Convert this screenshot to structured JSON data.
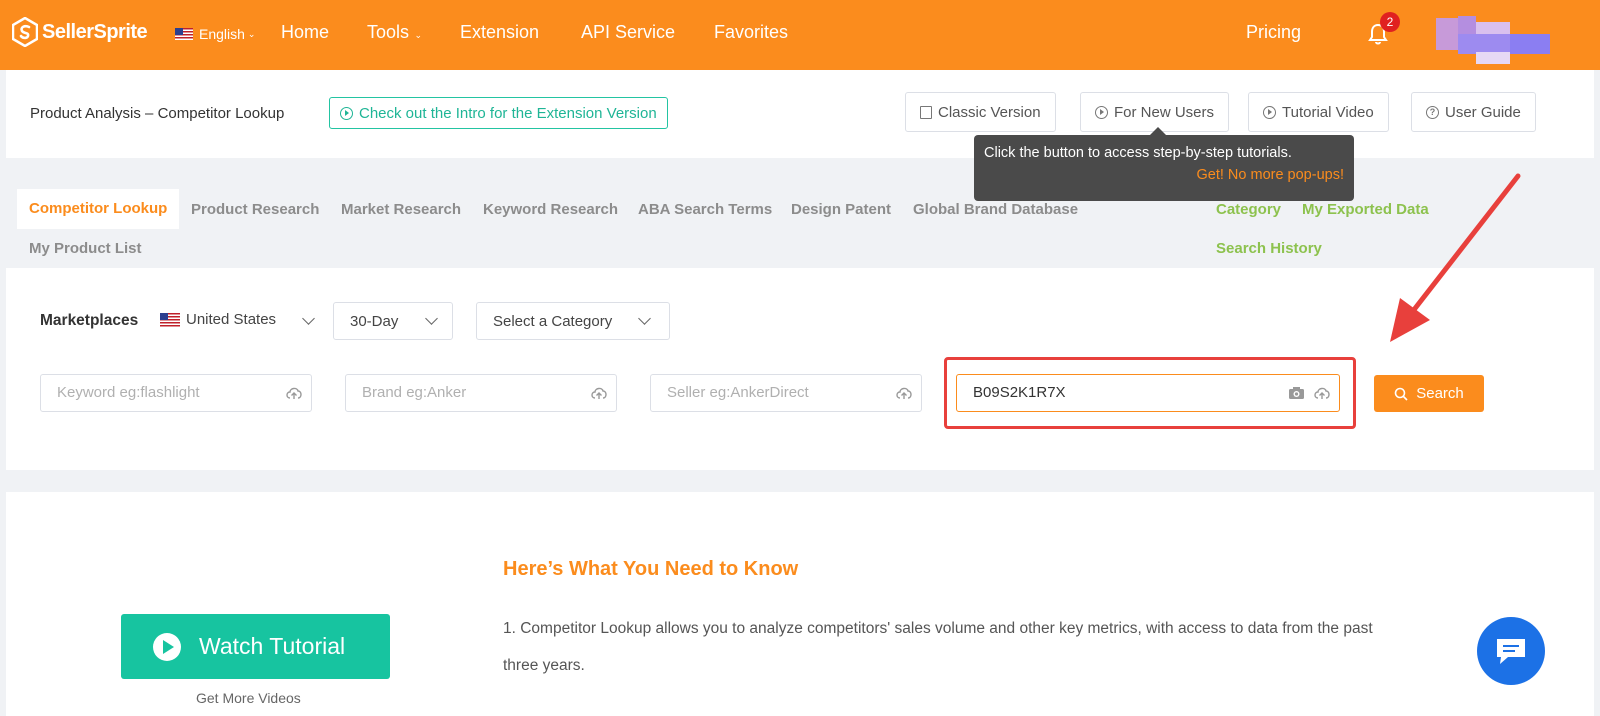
{
  "nav": {
    "brand": "SellerSprite",
    "language": "English",
    "links": [
      "Home",
      "Tools",
      "Extension",
      "API Service",
      "Favorites"
    ],
    "pricing": "Pricing",
    "notification_count": "2",
    "colors": {
      "brand": "#fb8c1d",
      "badge": "#e02020"
    }
  },
  "header": {
    "page_title": "Product Analysis – Competitor Lookup",
    "intro_button": "Check out the Intro for the Extension Version",
    "buttons": [
      "Classic Version",
      "For New Users",
      "Tutorial Video",
      "User Guide"
    ]
  },
  "tooltip": {
    "text": "Click the button to access step-by-step tutorials.",
    "dismiss": "Get! No more pop-ups!"
  },
  "tabs": {
    "items": [
      "Competitor Lookup",
      "Product Research",
      "Market Research",
      "Keyword Research",
      "ABA Search Terms",
      "Design Patent",
      "Global Brand Database"
    ],
    "row2": "My Product List",
    "right_links": [
      "Category",
      "My Exported Data",
      "Search History"
    ],
    "active": "Competitor Lookup"
  },
  "search": {
    "marketplaces_label": "Marketplaces",
    "marketplace": "United States",
    "period": "30-Day",
    "category_placeholder": "Select a Category",
    "keyword_placeholder": "Keyword eg:flashlight",
    "brand_placeholder": "Brand eg:Anker",
    "seller_placeholder": "Seller eg:AnkerDirect",
    "asin_value": "B09S2K1R7X",
    "search_button": "Search"
  },
  "content": {
    "watch_button": "Watch Tutorial",
    "more_videos": "Get More Videos",
    "title": "Here’s What You Need to Know",
    "point1": "1. Competitor Lookup allows you to analyze competitors' sales volume and other key metrics, with access to data from the past three years."
  }
}
